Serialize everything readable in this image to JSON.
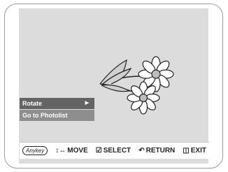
{
  "menu": {
    "items": [
      {
        "label": "Rotate",
        "selected": true
      },
      {
        "label": "Go to Photolist",
        "selected": false
      }
    ]
  },
  "nav": {
    "anykey": "Anykey",
    "move": "MOVE",
    "select": "SELECT",
    "return": "RETURN",
    "exit": "EXIT"
  },
  "icons": {
    "move": "move-arrows-icon",
    "select": "select-icon",
    "return": "return-icon",
    "exit": "exit-icon",
    "submenu": "submenu-arrow-icon"
  },
  "colors": {
    "screen_bg": "#dcdcdc",
    "menu_selected": "#646464",
    "menu_normal": "#8e8e8e"
  }
}
